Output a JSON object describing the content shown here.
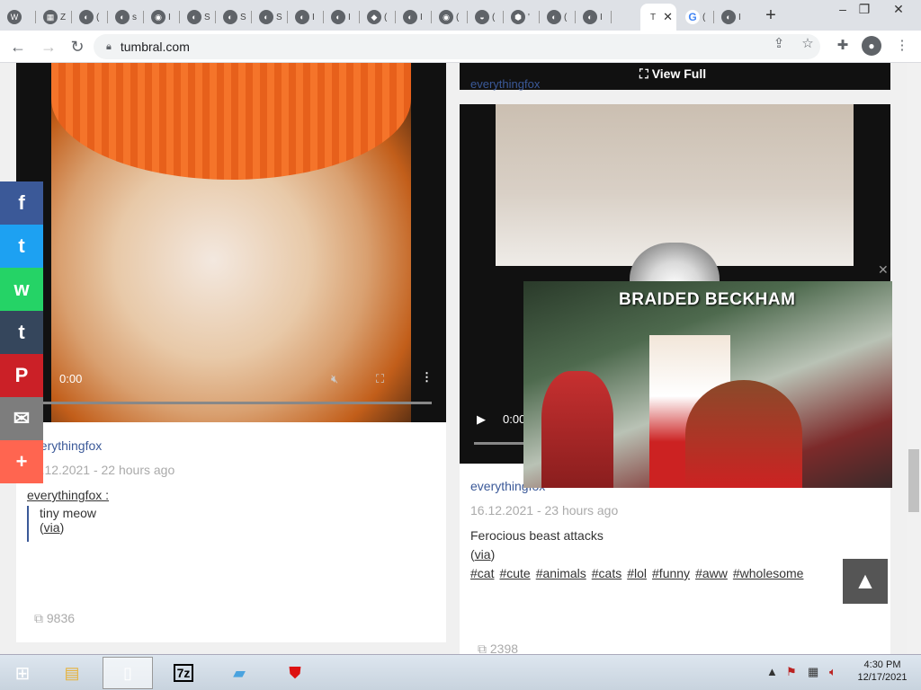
{
  "browser": {
    "tabs": [
      {
        "icon": "W",
        "label": ""
      },
      {
        "icon": "▦",
        "label": "Z"
      },
      {
        "icon": "◐",
        "label": "("
      },
      {
        "icon": "◐",
        "label": "s"
      },
      {
        "icon": "◉",
        "label": "I"
      },
      {
        "icon": "◐",
        "label": "S"
      },
      {
        "icon": "◐",
        "label": "S"
      },
      {
        "icon": "◐",
        "label": "S"
      },
      {
        "icon": "◐",
        "label": "I"
      },
      {
        "icon": "◐",
        "label": "I"
      },
      {
        "icon": "◆",
        "label": "("
      },
      {
        "icon": "◐",
        "label": "I"
      },
      {
        "icon": "◉",
        "label": "("
      },
      {
        "icon": "◒",
        "label": "("
      },
      {
        "icon": "⬢",
        "label": "'"
      },
      {
        "icon": "◐",
        "label": "("
      },
      {
        "icon": "◐",
        "label": "I"
      }
    ],
    "active_tab": {
      "label": "T",
      "close": "✕"
    },
    "google_tab": {
      "icon": "G",
      "label": "("
    },
    "last_tab": {
      "label": "I"
    },
    "new_tab": "+",
    "win_min": "–",
    "win_max": "❐",
    "win_close": "✕",
    "url": "tumbral.com"
  },
  "post_left": {
    "time": "0:00",
    "author": "everythingfox",
    "date": "16.12.2021 - 22 hours ago",
    "reblog_author": "everythingfox :",
    "text": "tiny meow",
    "via_prefix": "(",
    "via": "via",
    "via_suffix": ")",
    "notes": "9836"
  },
  "post_right": {
    "top_author": "everythingfox",
    "view_full": "View Full",
    "time": "0:00",
    "author": "everythingfox",
    "date": "16.12.2021 - 23 hours ago",
    "caption": "Ferocious beast attacks",
    "via_prefix": "(",
    "via": "via",
    "via_suffix": ")",
    "tags": [
      "#cat",
      "#cute",
      "#animals",
      "#cats",
      "#lol",
      "#funny",
      "#aww",
      "#wholesome"
    ],
    "notes": "2398"
  },
  "ad": {
    "title": "BRAIDED BECKHAM",
    "close": "✕"
  },
  "share": [
    {
      "name": "facebook",
      "glyph": "f",
      "color": "#3b5998"
    },
    {
      "name": "twitter",
      "glyph": "t",
      "color": "#1da1f2"
    },
    {
      "name": "whatsapp",
      "glyph": "w",
      "color": "#25d366"
    },
    {
      "name": "tumblr",
      "glyph": "t",
      "color": "#35465c"
    },
    {
      "name": "pinterest",
      "glyph": "P",
      "color": "#cb2027"
    },
    {
      "name": "email",
      "glyph": "✉",
      "color": "#7d7d7d"
    },
    {
      "name": "more",
      "glyph": "+",
      "color": "#ff6550"
    }
  ],
  "scroll_top": "▲",
  "taskbar": {
    "time": "4:30 PM",
    "date": "12/17/2021"
  }
}
